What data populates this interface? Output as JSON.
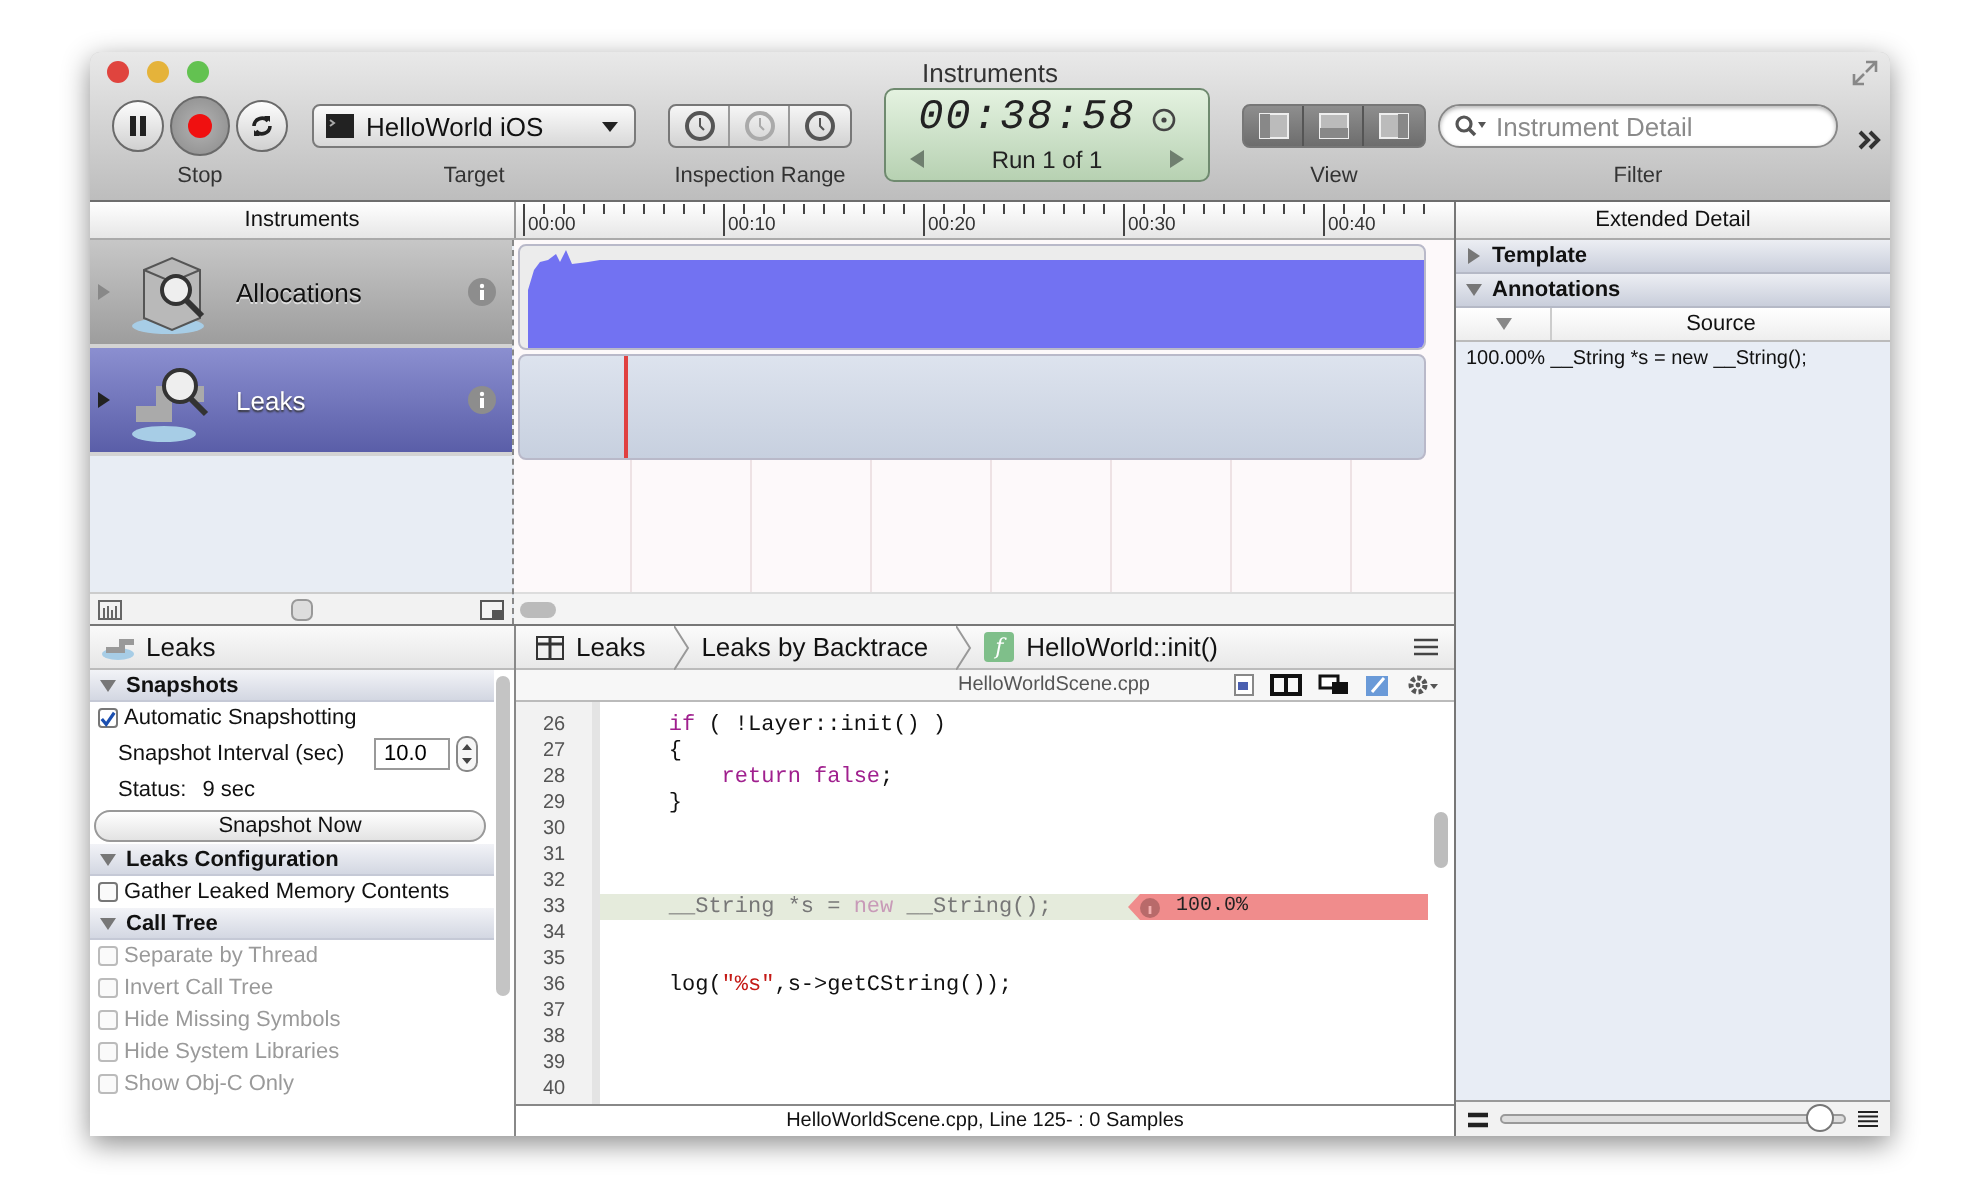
{
  "window": {
    "title": "Instruments"
  },
  "toolbar": {
    "record": {
      "label": "Stop",
      "recording": true
    },
    "target": {
      "label": "Target",
      "value": "HelloWorld iOS"
    },
    "inspection_range": {
      "label": "Inspection Range"
    },
    "clock": {
      "time": "00:38:58",
      "run": "Run 1 of 1"
    },
    "view": {
      "label": "View"
    },
    "filter": {
      "label": "Filter",
      "placeholder": "Instrument Detail"
    }
  },
  "instruments_header": "Instruments",
  "ruler": [
    "00:00",
    "00:10",
    "00:20",
    "00:30",
    "00:40"
  ],
  "instruments": [
    {
      "name": "Allocations",
      "kind": "allocations",
      "selected": false
    },
    {
      "name": "Leaks",
      "kind": "leaks",
      "selected": true
    }
  ],
  "detail": {
    "title": "Leaks",
    "sections": [
      {
        "title": "Snapshots",
        "expanded": true,
        "items": [
          {
            "kind": "checkbox",
            "label": "Automatic Snapshotting",
            "checked": true,
            "disabled": false
          },
          {
            "kind": "stepper",
            "label": "Snapshot Interval (sec)",
            "value": "10.0"
          },
          {
            "kind": "status",
            "label": "Status:",
            "value": "9 sec"
          },
          {
            "kind": "button",
            "label": "Snapshot Now"
          }
        ]
      },
      {
        "title": "Leaks Configuration",
        "expanded": true,
        "items": [
          {
            "kind": "checkbox",
            "label": "Gather Leaked Memory Contents",
            "checked": false,
            "disabled": false
          }
        ]
      },
      {
        "title": "Call Tree",
        "expanded": true,
        "items": [
          {
            "kind": "checkbox",
            "label": "Separate by Thread",
            "checked": false,
            "disabled": true
          },
          {
            "kind": "checkbox",
            "label": "Invert Call Tree",
            "checked": false,
            "disabled": true
          },
          {
            "kind": "checkbox",
            "label": "Hide Missing Symbols",
            "checked": false,
            "disabled": true
          },
          {
            "kind": "checkbox",
            "label": "Hide System Libraries",
            "checked": false,
            "disabled": true
          },
          {
            "kind": "checkbox",
            "label": "Show Obj-C Only",
            "checked": false,
            "disabled": true
          }
        ]
      }
    ]
  },
  "breadcrumbs": [
    {
      "kind": "table",
      "label": "Leaks"
    },
    {
      "kind": "plain",
      "label": "Leaks by Backtrace"
    },
    {
      "kind": "function",
      "label": "HelloWorld::init()",
      "badge": "f"
    }
  ],
  "file": "HelloWorldScene.cpp",
  "code": [
    {
      "number": "26",
      "highlighted": false,
      "tokens": [
        {
          "kind": "keyword",
          "text": "    if"
        },
        {
          "kind": "plain",
          "text": " ( !Layer::init() )"
        }
      ]
    },
    {
      "number": "27",
      "highlighted": false,
      "tokens": [
        {
          "kind": "plain",
          "text": "    {"
        }
      ]
    },
    {
      "number": "28",
      "highlighted": false,
      "tokens": [
        {
          "kind": "keyword",
          "text": "        return false"
        },
        {
          "kind": "plain",
          "text": ";"
        }
      ]
    },
    {
      "number": "29",
      "highlighted": false,
      "tokens": [
        {
          "kind": "plain",
          "text": "    }"
        }
      ]
    },
    {
      "number": "30",
      "highlighted": false
    },
    {
      "number": "31",
      "highlighted": false
    },
    {
      "number": "32",
      "highlighted": false
    },
    {
      "number": "33",
      "highlighted": true,
      "annotation": "100.0%",
      "tokens": [
        {
          "kind": "plain",
          "text": "    __String *s = "
        },
        {
          "kind": "keyword",
          "text": "new"
        },
        {
          "kind": "plain",
          "text": " __String();"
        }
      ]
    },
    {
      "number": "34",
      "highlighted": false
    },
    {
      "number": "35",
      "highlighted": false
    },
    {
      "number": "36",
      "highlighted": false,
      "tokens": [
        {
          "kind": "plain",
          "text": "    log("
        },
        {
          "kind": "string",
          "text": "\"%s\""
        },
        {
          "kind": "plain",
          "text": ",s->getCString());"
        }
      ]
    },
    {
      "number": "37",
      "highlighted": false
    },
    {
      "number": "38",
      "highlighted": false
    },
    {
      "number": "39",
      "highlighted": false
    },
    {
      "number": "40",
      "highlighted": false
    }
  ],
  "status": "HelloWorldScene.cpp, Line 125- : 0 Samples",
  "extended_detail": {
    "title": "Extended Detail",
    "sections": [
      {
        "title": "Template",
        "expanded": false
      },
      {
        "title": "Annotations",
        "expanded": true
      }
    ],
    "column": "Source",
    "rows": [
      "100.00% __String *s = new __String();"
    ],
    "zoom": {
      "level": 0.93
    }
  }
}
